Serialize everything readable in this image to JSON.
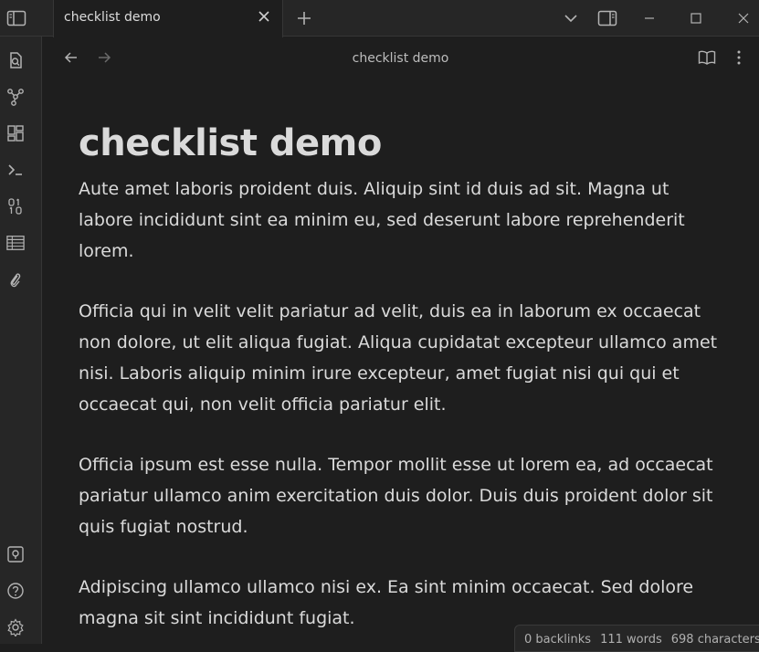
{
  "tab": {
    "title": "checklist demo"
  },
  "navbar": {
    "title": "checklist demo"
  },
  "document": {
    "heading": "checklist demo",
    "paragraphs": [
      "Aute amet laboris proident duis. Aliquip sint id duis ad sit. Magna ut labore incididunt sint ea minim eu, sed deserunt labore reprehenderit lorem.",
      "Officia qui in velit velit pariatur ad velit, duis ea in laborum ex occaecat non dolore, ut elit aliqua fugiat. Aliqua cupidatat excepteur ullamco amet nisi. Laboris aliquip minim irure excepteur, amet fugiat nisi qui qui et occaecat qui, non velit officia pariatur elit.",
      "Officia ipsum est esse nulla. Tempor mollit esse ut lorem ea, ad occaecat pariatur ullamco anim exercitation duis dolor. Duis duis proident dolor sit quis fugiat nostrud.",
      "Adipiscing ullamco ullamco nisi ex. Ea sint minim occaecat. Sed dolore magna sit sint incididunt fugiat."
    ]
  },
  "status_bar": {
    "backlinks": "0 backlinks",
    "words": "111 words",
    "characters": "698 characters"
  },
  "icons": {
    "topbar": [
      "sidebar-toggle-icon",
      "close-icon",
      "plus-icon",
      "chevron-down-icon",
      "right-sidebar-icon",
      "minimize-icon",
      "maximize-icon",
      "window-close-icon"
    ],
    "ribbon": [
      "open-file-icon",
      "graph-icon",
      "canvas-icon",
      "terminal-icon",
      "binary-icon",
      "table-icon",
      "paperclip-icon",
      "vault-icon",
      "help-icon",
      "settings-icon"
    ],
    "navbar": [
      "back-arrow-icon",
      "forward-arrow-icon",
      "reading-view-icon",
      "more-options-icon"
    ]
  },
  "colors": {
    "background": "#1e1e1e",
    "chrome": "#262626",
    "text": "#dadada",
    "border": "#363636"
  }
}
